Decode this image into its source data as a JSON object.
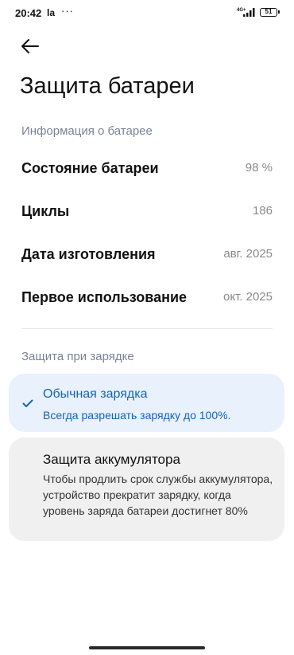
{
  "status": {
    "time": "20:42",
    "app_glyph": "la",
    "more": "···",
    "network": "4G+",
    "battery": "51"
  },
  "icons": {
    "back": "arrow-left",
    "check": "checkmark"
  },
  "colors": {
    "accent": "#1662b8",
    "selected_bg": "#e8f1fc",
    "card_bg": "#f0f0f0",
    "section_header": "#7a8294"
  },
  "page": {
    "title": "Защита батареи"
  },
  "battery_info": {
    "header": "Информация о батарее",
    "rows": [
      {
        "label": "Состояние батареи",
        "value": "98 %"
      },
      {
        "label": "Циклы",
        "value": "186"
      },
      {
        "label": "Дата изготовления",
        "value": "авг. 2025"
      },
      {
        "label": "Первое использование",
        "value": "окт. 2025"
      }
    ]
  },
  "charging": {
    "header": "Защита при зарядке",
    "options": [
      {
        "title": "Обычная зарядка",
        "description": "Всегда разрешать зарядку до 100%.",
        "selected": true
      },
      {
        "title": "Защита аккумулятора",
        "description": "Чтобы продлить срок службы аккумулятора, устройство прекратит зарядку, когда уровень заряда батареи достигнет 80%",
        "selected": false
      }
    ]
  }
}
